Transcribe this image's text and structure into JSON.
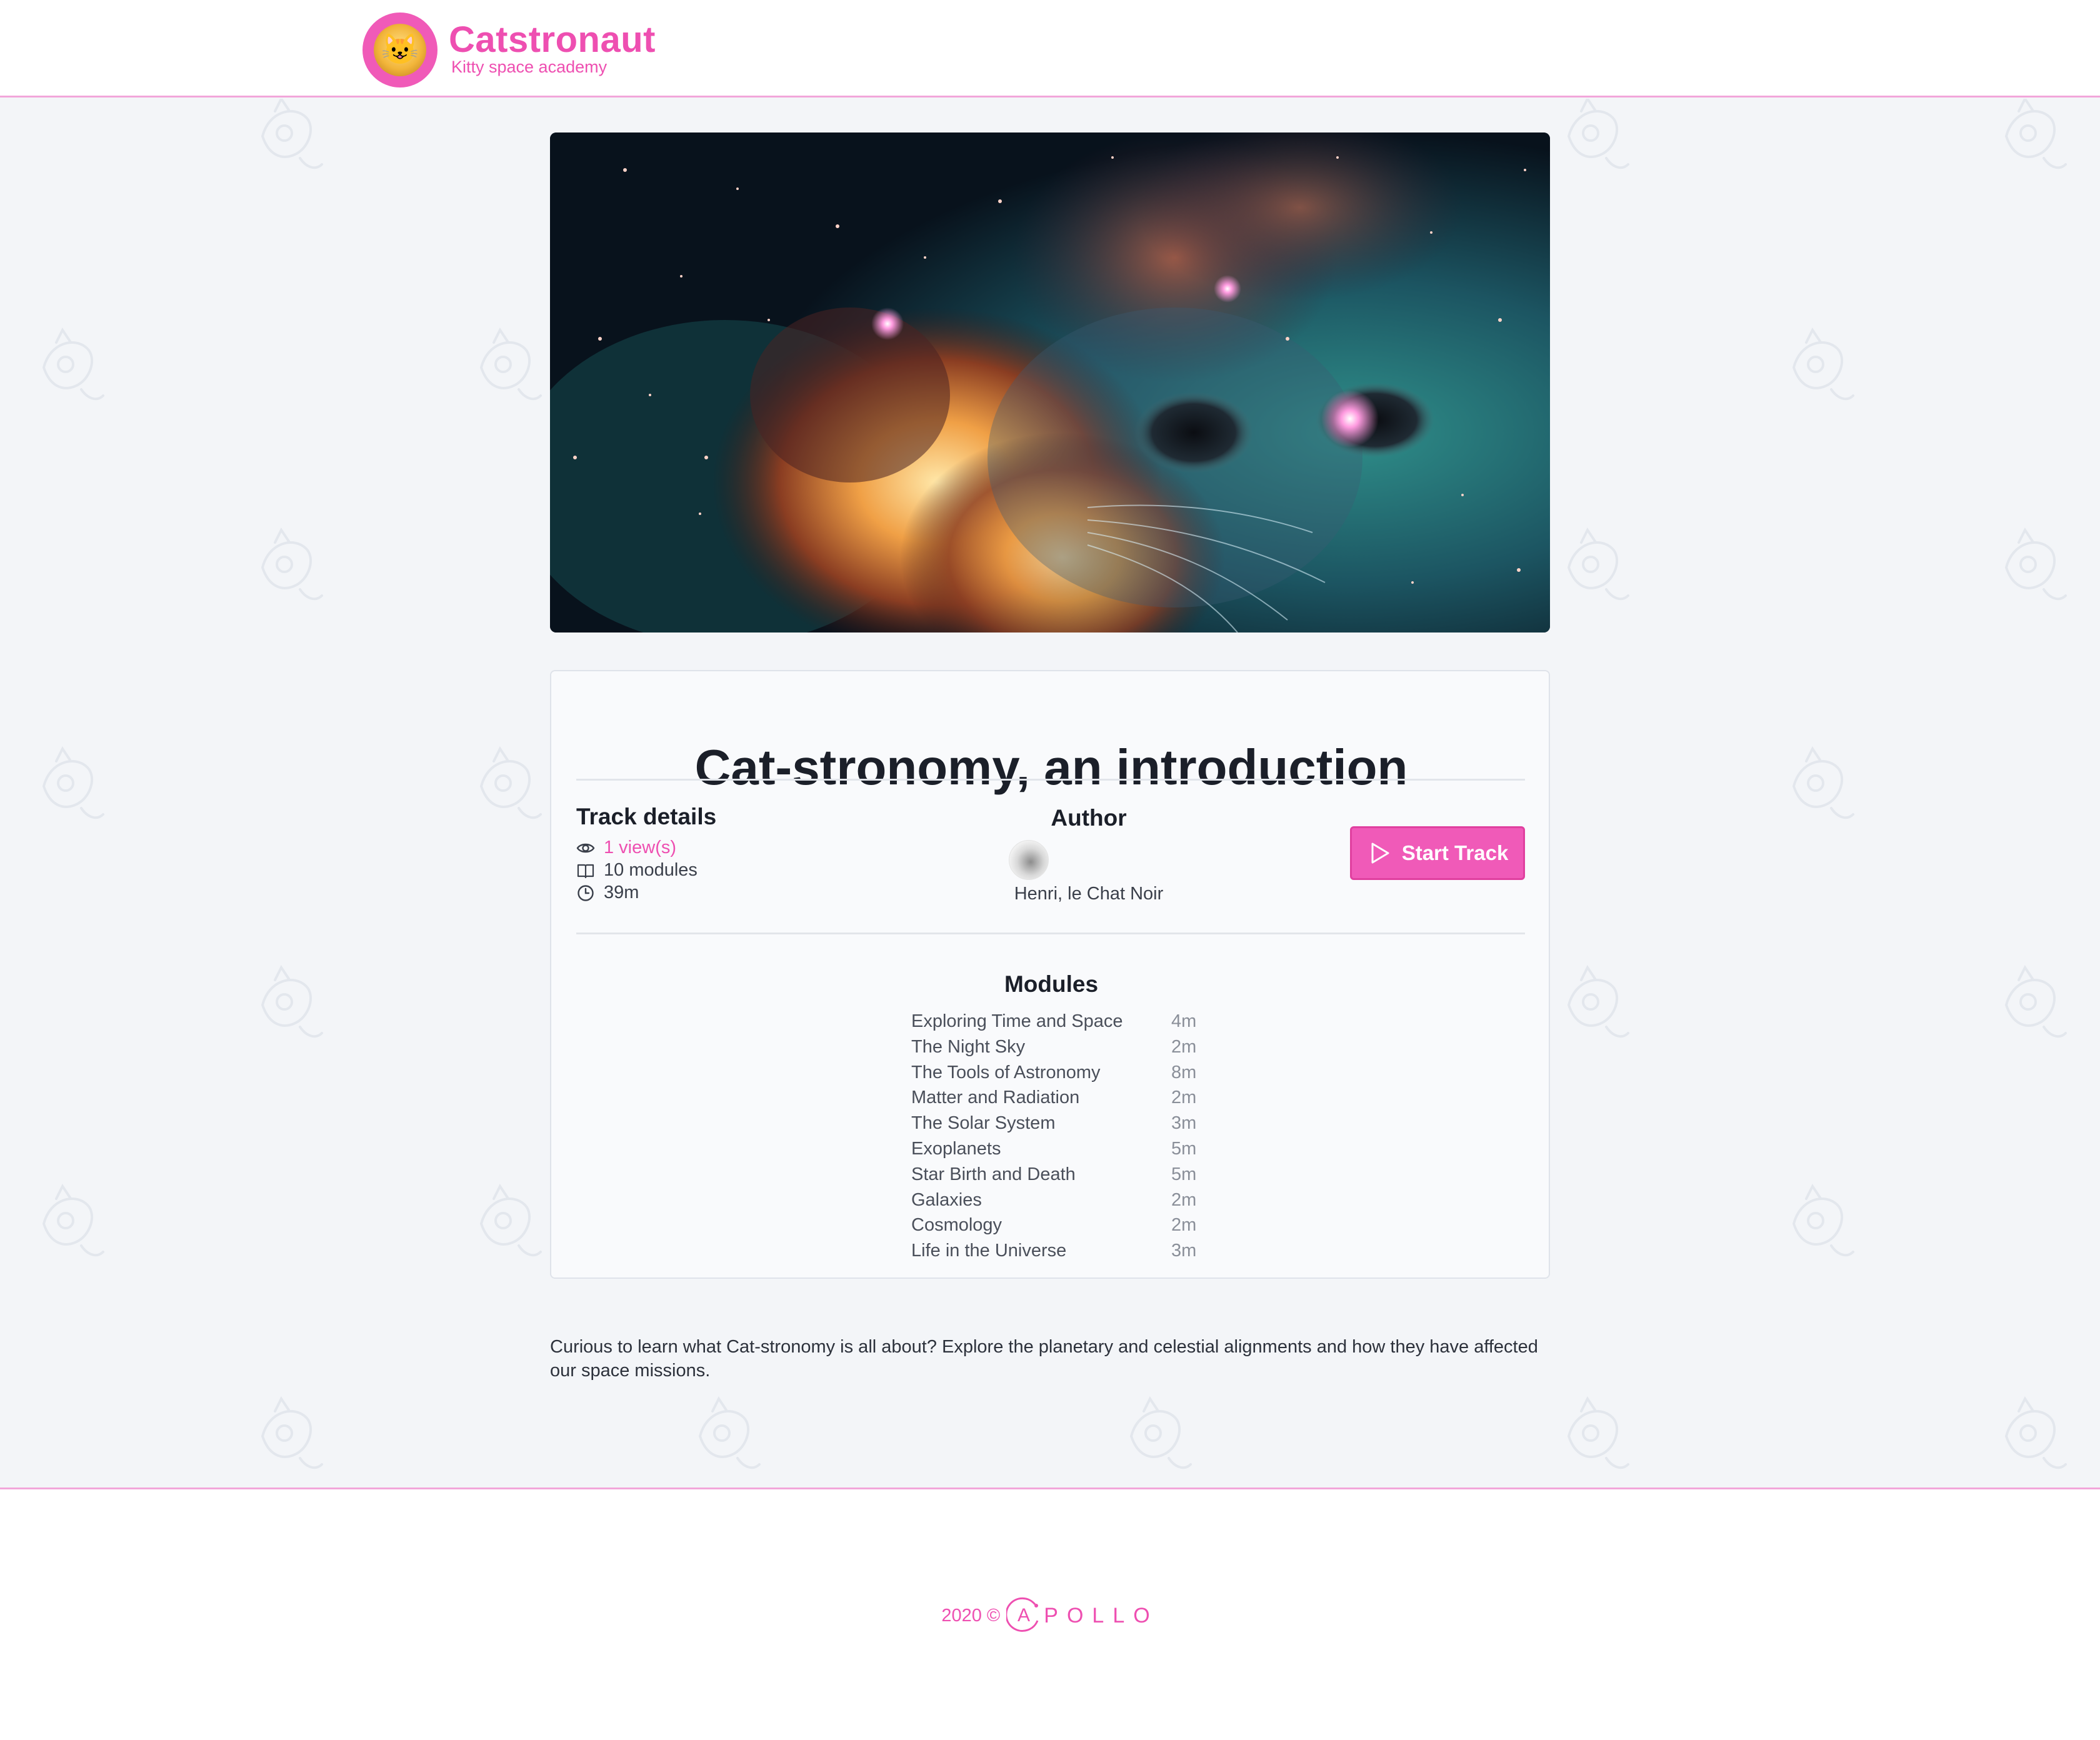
{
  "header": {
    "brand_name": "Catstronaut",
    "brand_subtitle": "Kitty space academy"
  },
  "track": {
    "title": "Cat-stronomy, an introduction",
    "details_heading": "Track details",
    "views": "1 view(s)",
    "modules_count": "10 modules",
    "duration": "39m",
    "author_heading": "Author",
    "author_name": "Henri, le Chat Noir",
    "start_button": "Start Track",
    "modules_heading": "Modules",
    "modules": [
      {
        "title": "Exploring Time and Space",
        "length": "4m"
      },
      {
        "title": "The Night Sky",
        "length": "2m"
      },
      {
        "title": "The Tools of Astronomy",
        "length": "8m"
      },
      {
        "title": "Matter and Radiation",
        "length": "2m"
      },
      {
        "title": "The Solar System",
        "length": "3m"
      },
      {
        "title": "Exoplanets",
        "length": "5m"
      },
      {
        "title": "Star Birth and Death",
        "length": "5m"
      },
      {
        "title": "Galaxies",
        "length": "2m"
      },
      {
        "title": "Cosmology",
        "length": "2m"
      },
      {
        "title": "Life in the Universe",
        "length": "3m"
      }
    ],
    "description": "Curious to learn what Cat-stronomy is all about? Explore the planetary and celestial alignments and how they have affected our space missions."
  },
  "footer": {
    "year": "2020 ©",
    "apollo_initial": "A",
    "apollo_rest": "POLLO"
  },
  "colors": {
    "brand_pink": "#ee4fb1",
    "button_pink": "#f05ab8",
    "page_background": "#f3f5f8"
  },
  "icons": {
    "views": "eye-icon",
    "modules": "book-icon",
    "duration": "clock-icon",
    "start": "play-icon"
  }
}
